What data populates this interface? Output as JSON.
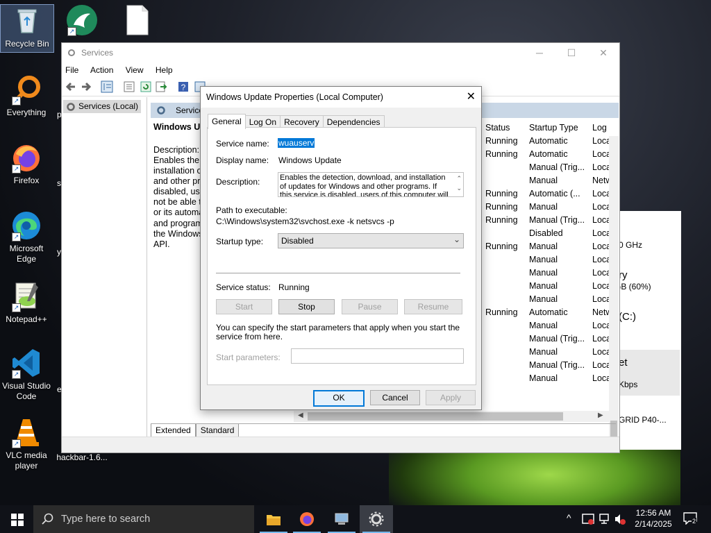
{
  "desktop": {
    "icons": [
      {
        "label": "Recycle Bin"
      },
      {
        "label": "Everything"
      },
      {
        "label": "Firefox"
      },
      {
        "label": "Microsoft Edge"
      },
      {
        "label": "Notepad++"
      },
      {
        "label": "Visual Studio Code"
      },
      {
        "label": "VLC media player"
      },
      {
        "label": "hackbar-1.6..."
      }
    ],
    "edge_letters": {
      "p": "p",
      "s": "s",
      "y": "y",
      "e": "e"
    }
  },
  "services_window": {
    "title": "Services",
    "menu": [
      "File",
      "Action",
      "View",
      "Help"
    ],
    "left_tree": "Services (Local)",
    "right_header": "Service",
    "detail_title": "Windows Up",
    "detail_desc_label": "Description:",
    "detail_lines": [
      "Enables the d",
      "installation o",
      "and other pro",
      "disabled, use",
      "not be able t",
      "or its automa",
      "and program",
      "the Windows",
      "API."
    ],
    "columns": {
      "status": "Status",
      "startup": "Startup Type",
      "log": "Log"
    },
    "rows": [
      {
        "status": "Running",
        "startup": "Automatic",
        "log": "Loca"
      },
      {
        "status": "Running",
        "startup": "Automatic",
        "log": "Loca"
      },
      {
        "status": "",
        "startup": "Manual (Trig...",
        "log": "Loca"
      },
      {
        "status": "",
        "startup": "Manual",
        "log": "Netw"
      },
      {
        "status": "Running",
        "startup": "Automatic (...",
        "log": "Loca"
      },
      {
        "status": "Running",
        "startup": "Manual",
        "log": "Loca"
      },
      {
        "status": "Running",
        "startup": "Manual (Trig...",
        "log": "Loca"
      },
      {
        "status": "",
        "startup": "Disabled",
        "log": "Loca"
      },
      {
        "status": "Running",
        "startup": "Manual",
        "log": "Loca"
      },
      {
        "status": "",
        "startup": "Manual",
        "log": "Loca"
      },
      {
        "status": "",
        "startup": "Manual",
        "log": "Loca"
      },
      {
        "status": "",
        "startup": "Manual",
        "log": "Loca"
      },
      {
        "status": "",
        "startup": "Manual",
        "log": "Loca"
      },
      {
        "status": "Running",
        "startup": "Automatic",
        "log": "Netw"
      },
      {
        "status": "",
        "startup": "Manual",
        "log": "Loca"
      },
      {
        "status": "",
        "startup": "Manual (Trig...",
        "log": "Loca"
      },
      {
        "status": "",
        "startup": "Manual",
        "log": "Loca"
      },
      {
        "status": "",
        "startup": "Manual (Trig...",
        "log": "Loca"
      },
      {
        "status": "",
        "startup": "Manual",
        "log": "Loca"
      }
    ],
    "tabs": [
      "Extended",
      "Standard"
    ]
  },
  "behind_window": {
    "lines": [
      "0 GHz",
      "ry",
      "GB (60%)",
      "(C:)",
      "et",
      "Kbps",
      "GRID P40-..."
    ]
  },
  "dialog": {
    "title": "Windows Update Properties (Local Computer)",
    "tabs": [
      "General",
      "Log On",
      "Recovery",
      "Dependencies"
    ],
    "service_name_label": "Service name:",
    "service_name": "wuauserv",
    "display_name_label": "Display name:",
    "display_name": "Windows Update",
    "description_label": "Description:",
    "description": "Enables the detection, download, and installation of updates for Windows and other programs. If this service is disabled, users of this computer will not be",
    "path_label": "Path to executable:",
    "path": "C:\\Windows\\system32\\svchost.exe -k netsvcs -p",
    "startup_type_label": "Startup type:",
    "startup_type": "Disabled",
    "service_status_label": "Service status:",
    "service_status": "Running",
    "buttons": {
      "start": "Start",
      "stop": "Stop",
      "pause": "Pause",
      "resume": "Resume"
    },
    "hint": "You can specify the start parameters that apply when you start the service from here.",
    "start_params_label": "Start parameters:",
    "ok": "OK",
    "cancel": "Cancel",
    "apply": "Apply"
  },
  "taskbar": {
    "search_placeholder": "Type here to search",
    "time": "12:56 AM",
    "date": "2/14/2025",
    "notification_count": "2"
  },
  "colors": {
    "accent": "#0078d7",
    "selection": "#0078d7",
    "taskbar": "#101218"
  }
}
